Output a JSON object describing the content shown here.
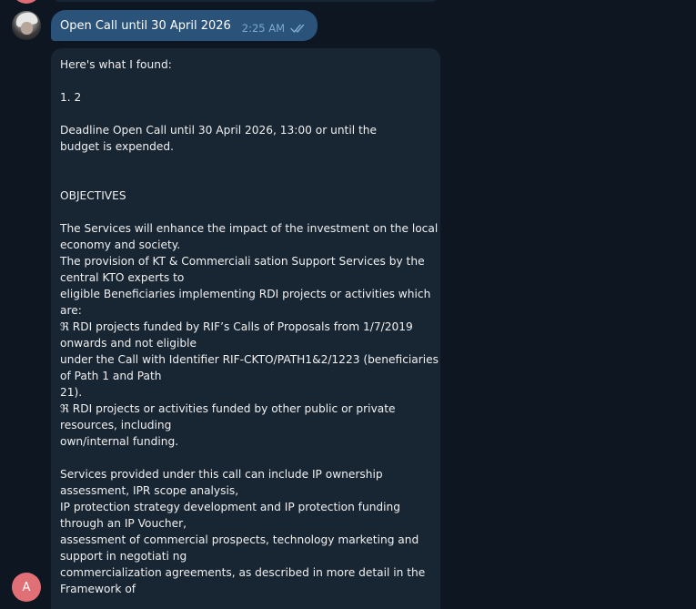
{
  "outgoing": {
    "text": "Open Call until 30 April 2026",
    "time": "2:25 AM",
    "status_icon": "double-check-icon"
  },
  "incoming": {
    "lines": [
      "Here's what I found:",
      "",
      "1. 2",
      "",
      "Deadline Open Call until 30 April 2026, 13:00 or until the",
      "budget is expended.",
      "",
      "",
      "OBJECTIVES",
      "",
      "The Services will enhance the impact of the investment on the local",
      "economy and society.",
      "The provision of KT & Commerciali sation Support Services by the",
      "central KTO experts to",
      "eligible Beneficiaries implementing RDI projects or activities which",
      "are:",
      "ℜ RDI projects funded by RIF’s Calls of Proposals  from 1/7/2019",
      "onwards and not eligible",
      "under the Call with Identifier RIF-CKTO/PATH1&2/1223 (beneficiaries",
      "of Path 1 and Path",
      "21).",
      "ℜ RDI projects or activities funded by other public or private",
      "resources, including",
      "own/internal funding.",
      "",
      "Services provided under this call can include IP ownership",
      "assessment, IPR scope analysis,",
      "IP protection strategy development and IP protection funding",
      "through an IP Voucher,",
      "assessment of commercial prospects, technology marketing and",
      "support in negotiati ng",
      "commercialization agreements, as described in more detail in the",
      "Framework of"
    ]
  },
  "bot_avatar": {
    "initial": "A",
    "color": "#e17076"
  },
  "colors": {
    "background": "#0e1621",
    "outgoing_bubble": "#2b5278",
    "incoming_bubble": "#182533",
    "tick": "#7da8d3"
  }
}
